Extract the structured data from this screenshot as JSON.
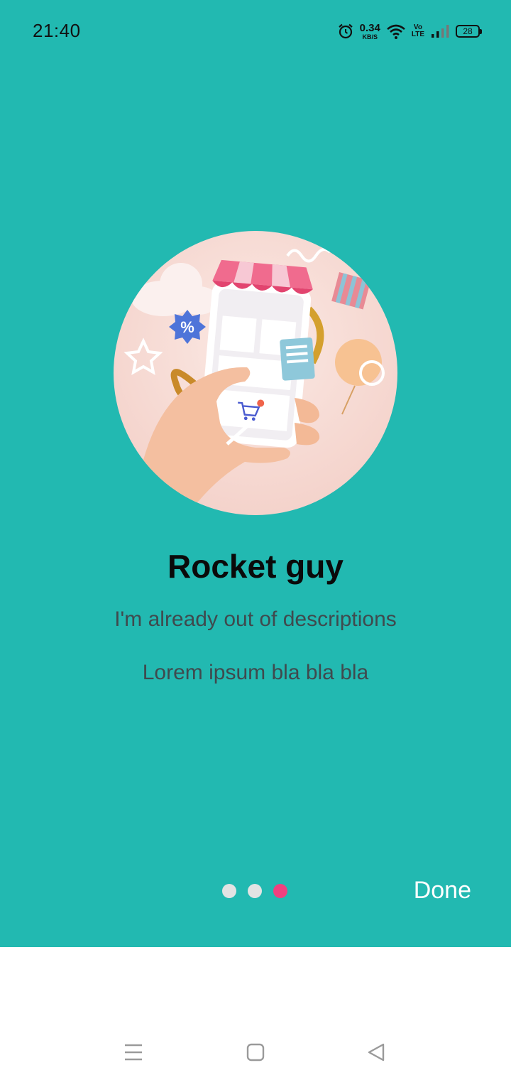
{
  "status_bar": {
    "time": "21:40",
    "net_speed_value": "0.34",
    "net_speed_unit": "KB/S",
    "volte_top": "Vo",
    "volte_bottom": "LTE",
    "battery": "28",
    "icons": [
      "alarm-icon",
      "wifi-icon",
      "signal-icon",
      "battery-icon"
    ]
  },
  "onboarding": {
    "title": "Rocket guy",
    "subtitle": "I'm already out of descriptions",
    "body": "Lorem ipsum bla bla bla",
    "illustration": "hand-holding-phone-shop-illustration",
    "pager": {
      "pages": 3,
      "current": 3
    },
    "done_label": "Done"
  },
  "nav_bar": {
    "icons": [
      "menu-icon",
      "home-icon",
      "back-icon"
    ]
  },
  "colors": {
    "background": "#22b9b1",
    "active_dot": "#f0407f",
    "inactive_dot": "#e3e3e3"
  }
}
